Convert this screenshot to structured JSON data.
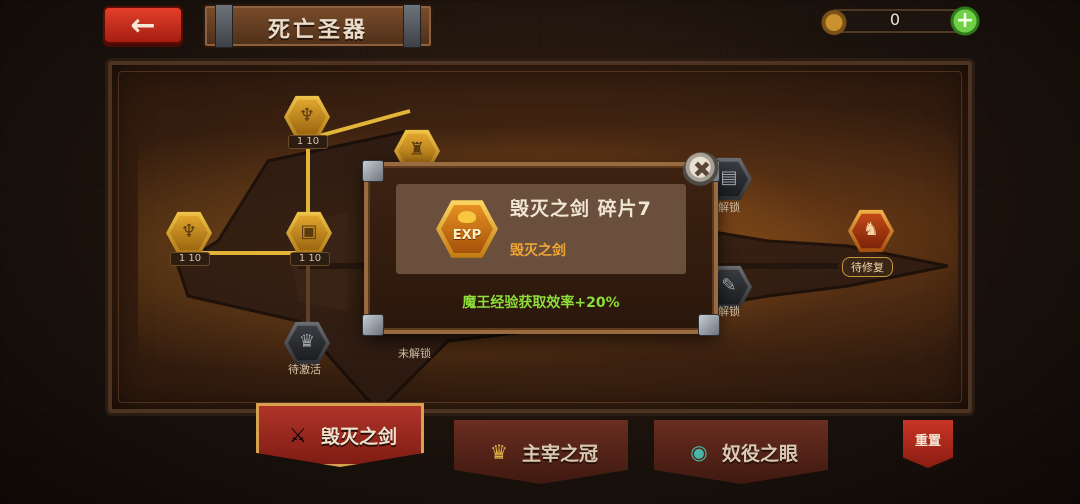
{
  "header": {
    "back_arrow": "←",
    "title": "死亡圣器",
    "currency_value": "0",
    "add_symbol": "+"
  },
  "tree": {
    "nodes": [
      {
        "id": "n1",
        "count": "1 10"
      },
      {
        "id": "n2",
        "count": ""
      },
      {
        "id": "n3",
        "count": "1 10"
      },
      {
        "id": "n4",
        "count": "1 10"
      },
      {
        "id": "n5",
        "count": ""
      }
    ],
    "captions": {
      "to_activate": "待激活",
      "locked_a": "未解锁",
      "locked_b": "解锁",
      "locked_c": "解锁",
      "to_repair": "待修复"
    }
  },
  "modal": {
    "icon_label": "EXP",
    "item_name": "毁灭之剑 碎片7",
    "item_source": "毁灭之剑",
    "effect_text": "魔王经验获取效率+20%",
    "close_symbol": "✖"
  },
  "tabs": [
    {
      "label": "毁灭之剑",
      "icon": "sword-icon",
      "active": true
    },
    {
      "label": "主宰之冠",
      "icon": "crown-icon",
      "active": false
    },
    {
      "label": "奴役之眼",
      "icon": "eye-icon",
      "active": false
    }
  ],
  "reset_label": "重置",
  "colors": {
    "effect": "#8cdc3a",
    "item_source": "#f0a534",
    "gold_node": "#e1a72d",
    "tab_active": "#b2362a"
  }
}
